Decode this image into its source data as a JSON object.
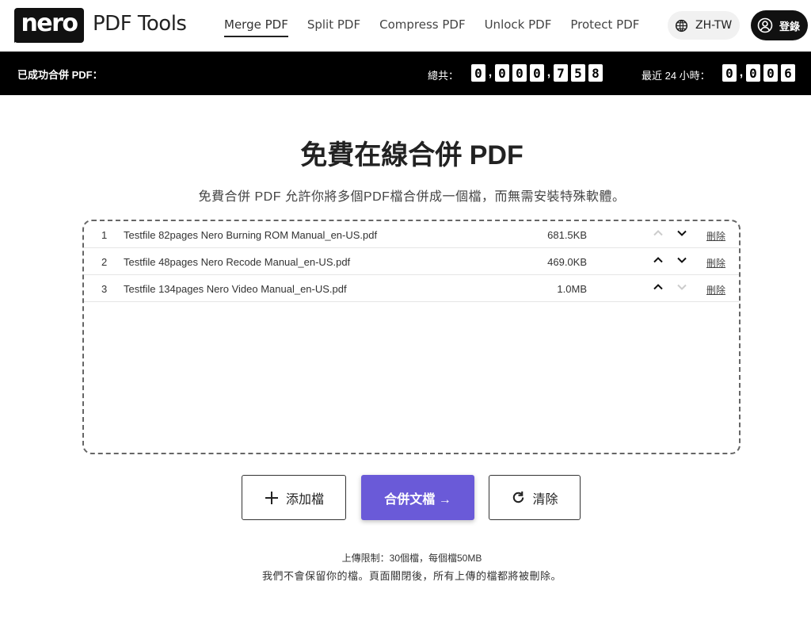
{
  "header": {
    "logo_text": "nero",
    "product": "PDF Tools",
    "nav": [
      "Merge PDF",
      "Split PDF",
      "Compress PDF",
      "Unlock PDF",
      "Protect PDF"
    ],
    "active_nav": "Merge PDF",
    "language": "ZH-TW",
    "login": "登錄"
  },
  "stats": {
    "label": "已成功合併 PDF：",
    "total_label": "總共：",
    "total_digits": [
      "0",
      ",",
      "0",
      "0",
      "0",
      ",",
      "7",
      "5",
      "8"
    ],
    "recent_label": "最近 24 小時：",
    "recent_digits": [
      "0",
      ",",
      "0",
      "0",
      "6"
    ]
  },
  "main": {
    "title": "免費在線合併 PDF",
    "subtitle": "免費合併 PDF 允許你將多個PDF檔合併成一個檔，而無需安裝特殊軟體。",
    "files": [
      {
        "index": "1",
        "name": "Testfile 82pages Nero Burning ROM Manual_en-US.pdf",
        "size": "681.5KB",
        "delete": "刪除",
        "up_enabled": false,
        "down_enabled": true
      },
      {
        "index": "2",
        "name": "Testfile 48pages Nero Recode Manual_en-US.pdf",
        "size": "469.0KB",
        "delete": "刪除",
        "up_enabled": true,
        "down_enabled": true
      },
      {
        "index": "3",
        "name": "Testfile 134pages Nero Video Manual_en-US.pdf",
        "size": "1.0MB",
        "delete": "刪除",
        "up_enabled": true,
        "down_enabled": false
      }
    ],
    "add_button": "添加檔",
    "merge_button": "合併文檔 →",
    "clear_button": "清除",
    "limit": "上傳限制：30個檔，每個檔50MB",
    "privacy": "我們不會保留你的檔。頁面關閉後，所有上傳的檔都將被刪除。"
  },
  "colors": {
    "accent": "#6a5ad8",
    "bar": "#000000",
    "disabled_arrow": "#cccccc"
  }
}
